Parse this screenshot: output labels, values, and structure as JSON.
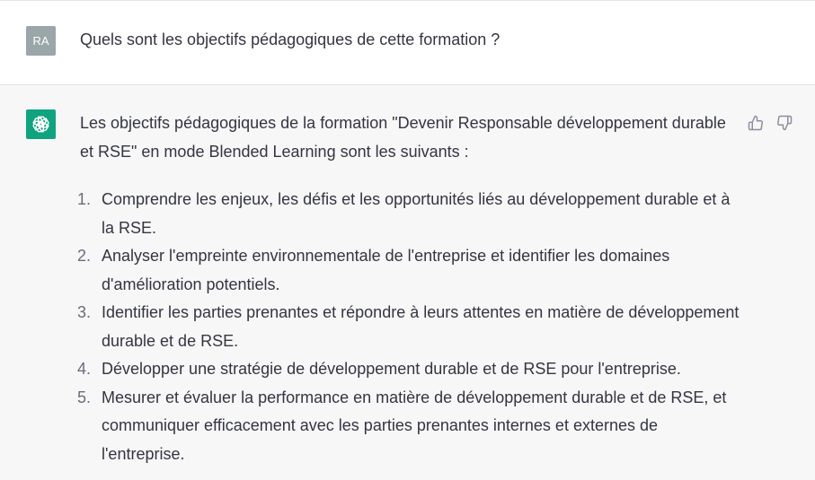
{
  "user_message": {
    "avatar_initials": "RA",
    "text": "Quels sont les objectifs pédagogiques de cette formation ?"
  },
  "assistant_message": {
    "intro": "Les objectifs pédagogiques de la formation \"Devenir Responsable développement durable et RSE\" en mode Blended Learning sont les suivants :",
    "items": [
      {
        "number": "1.",
        "text": "Comprendre les enjeux, les défis et les opportunités liés au développement durable et à la RSE."
      },
      {
        "number": "2.",
        "text": "Analyser l'empreinte environnementale de l'entreprise et identifier les domaines d'amélioration potentiels."
      },
      {
        "number": "3.",
        "text": "Identifier les parties prenantes et répondre à leurs attentes en matière de développement durable et de RSE."
      },
      {
        "number": "4.",
        "text": "Développer une stratégie de développement durable et de RSE pour l'entreprise."
      },
      {
        "number": "5.",
        "text": "Mesurer et évaluer la performance en matière de développement durable et de RSE, et communiquer efficacement avec les parties prenantes internes et externes de l'entreprise."
      }
    ]
  },
  "icons": {
    "assistant_logo": "openai-logo-icon",
    "like": "thumbs-up-icon",
    "dislike": "thumbs-down-icon"
  },
  "colors": {
    "assistant_avatar": "#10a37f",
    "user_avatar": "#9aa6a8",
    "assistant_background": "#f7f7f8",
    "text": "#343541"
  }
}
